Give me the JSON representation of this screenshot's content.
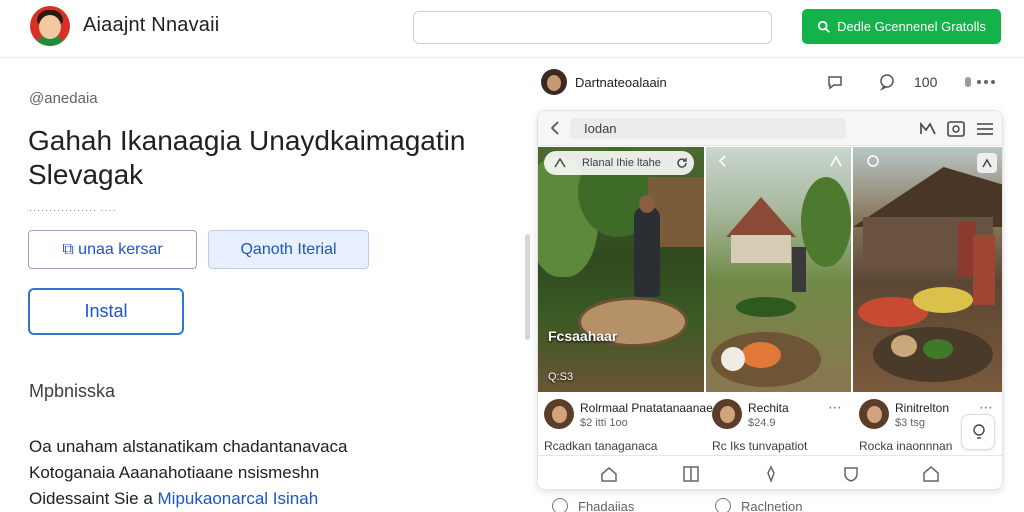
{
  "header": {
    "app_name": "Aiaajnt Nnavaii",
    "search": {
      "value": "",
      "placeholder": ""
    },
    "cta_label": "Dedle Gcennenel Gratolls",
    "brand_color": "#13b24a"
  },
  "main": {
    "handle": "@anedaia",
    "title": "Gahah Ikanaagia Unaydkaimagatin Slevagak",
    "meta": "················· ····",
    "buttons": {
      "primary_outline": "⧉ unaa kersar",
      "secondary": "Qanoth Iterial",
      "install": "Instal"
    },
    "section_heading": "Mpbnisska",
    "description": {
      "line1": "Oa unaham alstanatikam chadantanavaca",
      "line2": "Kotoganaia Aaanahotiaane nsismeshn",
      "line3_text": "Oidessaint Sie a ",
      "line3_link": "Mipukaonarcal Isinah"
    }
  },
  "post_panel": {
    "author": "Dartnateoalaain",
    "like_count": "100",
    "card": {
      "title": "Iodan",
      "photo1": {
        "pill_text": "Rlanal Ihie ltahe",
        "caption": "Fcsaahaar",
        "sub": "Q:S3"
      },
      "posts": [
        {
          "name": "Rolrmaal Pnatatanaanae",
          "price": "$2 itti 1oo",
          "text": "Rcadkan tanaganaca"
        },
        {
          "name": "Rechita",
          "price": "$24.9",
          "text": "Rc Iks tunvapatiot"
        },
        {
          "name": "Rinitrelton",
          "price": "$3 tsg",
          "text": "Rocka inaonnnan"
        }
      ]
    },
    "bottom_options": [
      "Fhadaiias",
      "Raclnetion"
    ]
  },
  "icons": {
    "search": "search-icon",
    "back": "back-arrow-icon",
    "comment": "comment-icon",
    "chat": "chat-icon",
    "more": "more-icon"
  }
}
